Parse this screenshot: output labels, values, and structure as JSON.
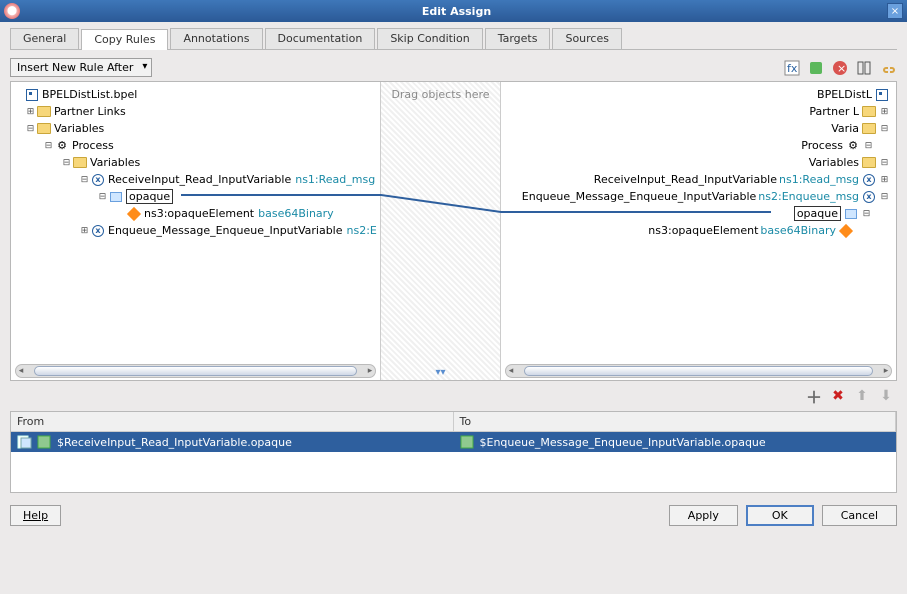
{
  "titlebar": {
    "title": "Edit Assign",
    "app_icon": "oracle-icon"
  },
  "tabs": [
    "General",
    "Copy Rules",
    "Annotations",
    "Documentation",
    "Skip Condition",
    "Targets",
    "Sources"
  ],
  "active_tab": 1,
  "dropdown_label": "Insert New Rule After",
  "top_toolbar_icons": [
    "fx-icon",
    "puzzle-green-icon",
    "error-red-icon",
    "column-icon",
    "link-icon"
  ],
  "mid_hint": "Drag objects here",
  "left_tree": {
    "root": "BPELDistList.bpel",
    "partner_links": "Partner Links",
    "variables": "Variables",
    "process": "Process",
    "variables2": "Variables",
    "recv": {
      "label": "ReceiveInput_Read_InputVariable",
      "type": "ns1:Read_msg"
    },
    "opaque": "opaque",
    "opaque_elem": {
      "label": "ns3:opaqueElement",
      "type": "base64Binary"
    },
    "enqueue": {
      "label": "Enqueue_Message_Enqueue_InputVariable",
      "type": "ns2:E"
    }
  },
  "right_tree": {
    "root": "BPELDistL",
    "partner_links": "Partner L",
    "variables": "Varia",
    "process": "Process",
    "variables2": "Variables",
    "recv": {
      "label": "ReceiveInput_Read_InputVariable",
      "type": "ns1:Read_msg"
    },
    "enqueue": {
      "label": "Enqueue_Message_Enqueue_InputVariable",
      "type": "ns2:Enqueue_msg"
    },
    "opaque": "opaque",
    "opaque_elem": {
      "label": "ns3:opaqueElement",
      "type": "base64Binary"
    }
  },
  "copy_table": {
    "headers": {
      "from": "From",
      "to": "To"
    },
    "row": {
      "from": "$ReceiveInput_Read_InputVariable.opaque",
      "to": "$Enqueue_Message_Enqueue_InputVariable.opaque"
    }
  },
  "buttons": {
    "help": "Help",
    "apply": "Apply",
    "ok": "OK",
    "cancel": "Cancel"
  }
}
